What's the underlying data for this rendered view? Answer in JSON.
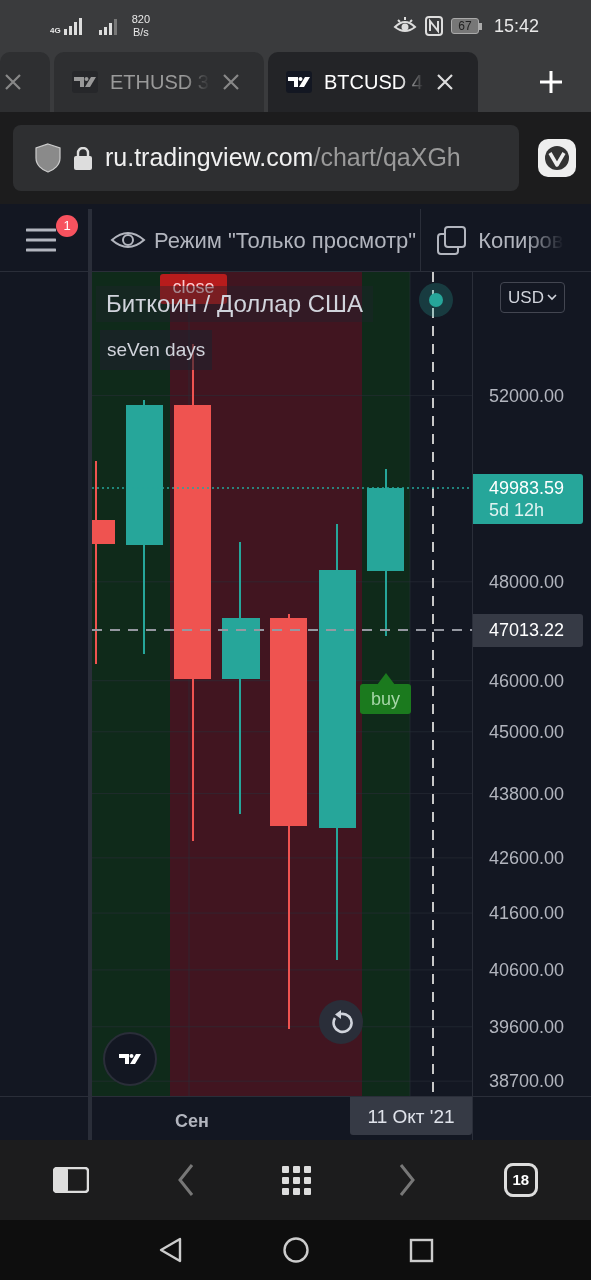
{
  "status_bar": {
    "network": "4G",
    "speed": "820",
    "speed_unit": "B/s",
    "battery": "67",
    "time": "15:42"
  },
  "browser_tabs": [
    {
      "selected": false
    },
    {
      "label": "ETHUSD 3",
      "selected": false
    },
    {
      "label": "BTCUSD 4",
      "selected": true
    }
  ],
  "address_bar": {
    "host": "ru.tradingview.com",
    "path": "/chart/qaXGh"
  },
  "toolbar": {
    "menu_badge": "1",
    "view_mode": "Режим \"Только просмотр\"",
    "copy": "Копиров"
  },
  "chart": {
    "title": "Биткоин / Доллар США",
    "indicator": "seVen days",
    "close_label": "close",
    "buy_label": "buy",
    "currency": "USD",
    "price_ticks": [
      "52000.00",
      "48000.00",
      "46000.00",
      "45000.00",
      "43800.00",
      "42600.00",
      "41600.00",
      "40600.00",
      "39600.00",
      "38700.00"
    ],
    "last_price": {
      "value": "49983.59",
      "countdown": "5d 12h"
    },
    "crosshair_price": "47013.22",
    "time_ticks": [
      "Сен"
    ],
    "crosshair_date": "11 Окт '21"
  },
  "tab_count": "18"
}
